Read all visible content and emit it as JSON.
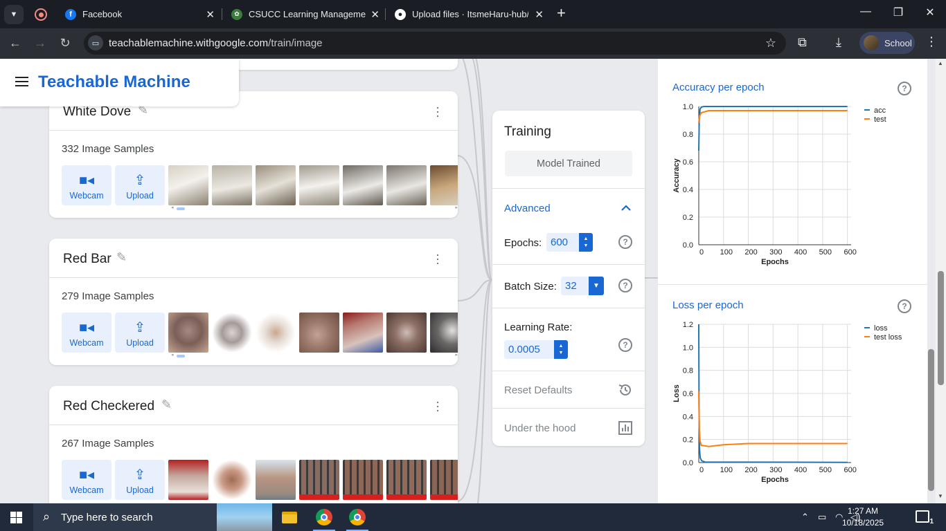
{
  "browser": {
    "tabs": [
      {
        "title": "Facebook",
        "icon": "facebook-icon"
      },
      {
        "title": "CSUCC Learning Management S",
        "icon": "lms-icon"
      },
      {
        "title": "Upload files · ItsmeHaru-hub/Ba",
        "icon": "github-icon"
      }
    ],
    "url_host": "teachablemachine.withgoogle.com",
    "url_path": "/train/image",
    "profile_label": "School"
  },
  "app": {
    "brand": "Teachable Machine"
  },
  "classes": [
    {
      "name": "White Dove",
      "samples": "332 Image Samples",
      "webcam": "Webcam",
      "upload": "Upload"
    },
    {
      "name": "Red Bar",
      "samples": "279 Image Samples",
      "webcam": "Webcam",
      "upload": "Upload"
    },
    {
      "name": "Red Checkered",
      "samples": "267 Image Samples",
      "webcam": "Webcam",
      "upload": "Upload"
    }
  ],
  "training": {
    "title": "Training",
    "status_button": "Model Trained",
    "advanced_label": "Advanced",
    "epochs_label": "Epochs:",
    "epochs_value": "600",
    "batch_label": "Batch Size:",
    "batch_value": "32",
    "lr_label": "Learning Rate:",
    "lr_value": "0.0005",
    "reset_label": "Reset Defaults",
    "hood_label": "Under the hood",
    "help_glyph": "?"
  },
  "charts": {
    "accuracy_title": "Accuracy per epoch",
    "loss_title": "Loss per epoch"
  },
  "chart_data": [
    {
      "type": "line",
      "title": "Accuracy per epoch",
      "xlabel": "Epochs",
      "ylabel": "Accuracy",
      "xlim": [
        0,
        615
      ],
      "ylim": [
        0,
        1.0
      ],
      "xticks": [
        0,
        100,
        200,
        300,
        400,
        500,
        600
      ],
      "yticks": [
        "0.0",
        "0.2",
        "0.4",
        "0.6",
        "0.8",
        "1.0"
      ],
      "legend_position": "top-right",
      "grid": true,
      "series": [
        {
          "name": "acc",
          "color": "#1f77b4",
          "x": [
            0,
            2,
            5,
            10,
            20,
            600
          ],
          "y": [
            0.68,
            0.9,
            0.98,
            0.995,
            1.0,
            1.0
          ]
        },
        {
          "name": "test",
          "color": "#ff7f0e",
          "x": [
            0,
            3,
            10,
            20,
            40,
            600
          ],
          "y": [
            0.88,
            0.93,
            0.955,
            0.96,
            0.97,
            0.97
          ]
        }
      ]
    },
    {
      "type": "line",
      "title": "Loss per epoch",
      "xlabel": "Epochs",
      "ylabel": "Loss",
      "xlim": [
        0,
        615
      ],
      "ylim": [
        0,
        1.2
      ],
      "xticks": [
        0,
        100,
        200,
        300,
        400,
        500,
        600
      ],
      "yticks": [
        "0.0",
        "0.2",
        "0.4",
        "0.6",
        "0.8",
        "1.0",
        "1.2"
      ],
      "legend_position": "top-right",
      "grid": true,
      "series": [
        {
          "name": "loss",
          "color": "#1f77b4",
          "x": [
            0,
            1,
            3,
            6,
            12,
            25,
            600
          ],
          "y": [
            1.2,
            0.5,
            0.12,
            0.04,
            0.015,
            0.005,
            0.002
          ]
        },
        {
          "name": "test loss",
          "color": "#ff7f0e",
          "x": [
            0,
            2,
            5,
            10,
            40,
            100,
            200,
            600
          ],
          "y": [
            0.62,
            0.3,
            0.19,
            0.15,
            0.14,
            0.155,
            0.165,
            0.165
          ]
        }
      ]
    }
  ],
  "taskbar": {
    "search_placeholder": "Type here to search",
    "time": "1:27 AM",
    "date": "10/18/2025",
    "notification_count": "1"
  }
}
